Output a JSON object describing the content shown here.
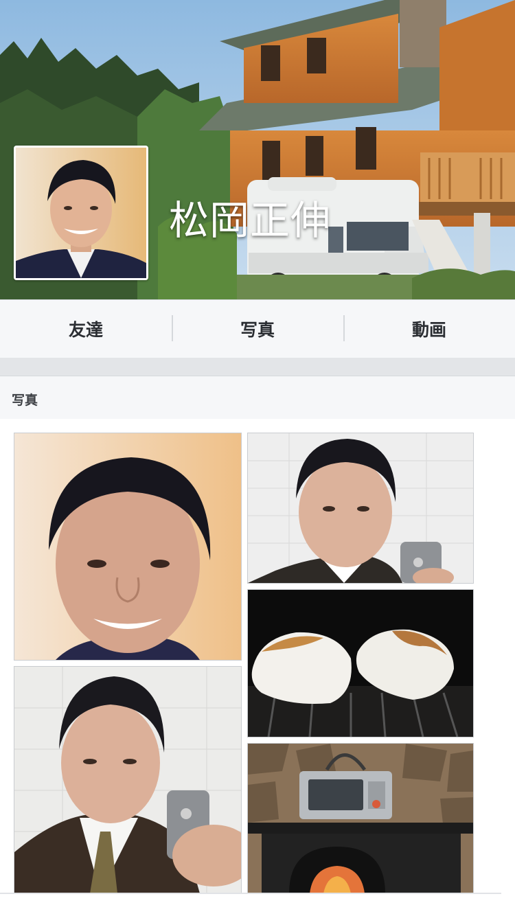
{
  "profile": {
    "name": "松岡正伸"
  },
  "tabs": [
    {
      "label": "友達"
    },
    {
      "label": "写真"
    },
    {
      "label": "動画"
    }
  ],
  "photos_section": {
    "title": "写真"
  },
  "colors": {
    "nav_background": "#f6f7f9",
    "divider": "#d5d8dc",
    "text_dark": "#2b2e33"
  }
}
